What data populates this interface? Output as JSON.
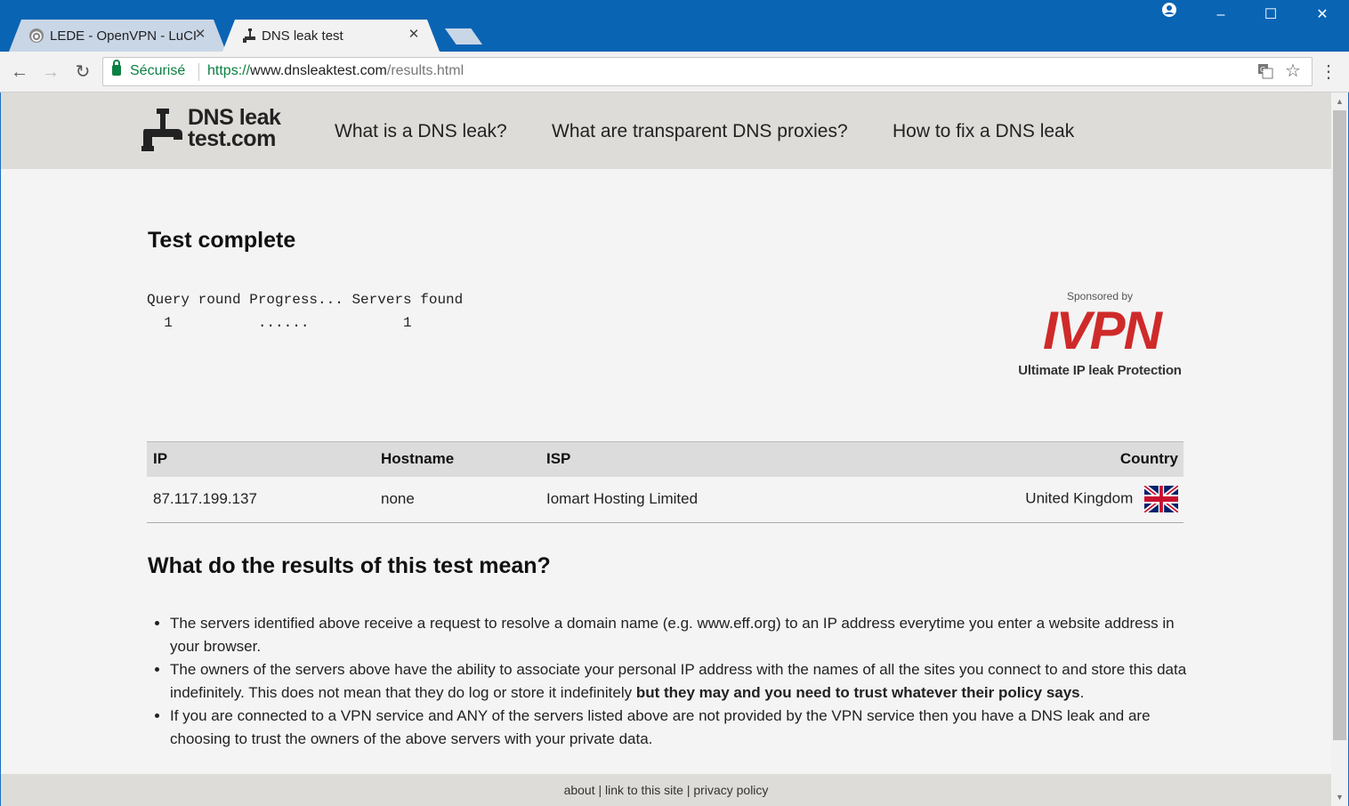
{
  "browser": {
    "tabs": [
      {
        "title": "LEDE - OpenVPN - LuCI",
        "icon": "signal-icon",
        "active": false
      },
      {
        "title": "DNS leak test",
        "icon": "faucet-icon",
        "active": true
      }
    ],
    "omnibox": {
      "secure_label": "Sécurisé",
      "url_scheme": "https://",
      "url_host": "www.dnsleaktest.com",
      "url_path": "/results.html"
    },
    "window_controls": {
      "minimize": "–",
      "maximize": "☐",
      "close": "✕"
    }
  },
  "site": {
    "logo": {
      "line1": "DNS leak",
      "line2": "test.com"
    },
    "nav": [
      "What is a DNS leak?",
      "What are transparent DNS proxies?",
      "How to fix a DNS leak"
    ]
  },
  "main": {
    "title": "Test complete",
    "progress": {
      "header": "Query round Progress... Servers found",
      "row": "  1          ......           1"
    },
    "sponsor": {
      "by": "Sponsored by",
      "brand": "IVPN",
      "tagline": "Ultimate IP leak Protection"
    },
    "table": {
      "headers": {
        "ip": "IP",
        "hostname": "Hostname",
        "isp": "ISP",
        "country": "Country"
      },
      "rows": [
        {
          "ip": "87.117.199.137",
          "hostname": "none",
          "isp": "Iomart Hosting Limited",
          "country": "United Kingdom",
          "flag_icon": "uk-flag-icon"
        }
      ]
    },
    "meaning": {
      "title": "What do the results of this test mean?",
      "items": [
        {
          "text": "The servers identified above receive a request to resolve a domain name (e.g. www.eff.org) to an IP address everytime you enter a website address in your browser."
        },
        {
          "text": "The owners of the servers above have the ability to associate your personal IP address with the names of all the sites you connect to and store this data indefinitely. This does not mean that they do log or store it indefinitely ",
          "bold": "but they may and you need to trust whatever their policy says",
          "tail": "."
        },
        {
          "text": "If you are connected to a VPN service and ANY of the servers listed above are not provided by the VPN service then you have a DNS leak and are choosing to trust the owners of the above servers with your private data."
        }
      ]
    }
  },
  "footer": {
    "about": "about",
    "sep1": " | ",
    "link": "link to this site",
    "sep2": " | ",
    "privacy": "privacy policy"
  },
  "colors": {
    "brand_red": "#cf2a2a",
    "secure_green": "#0b8043",
    "titlebar_blue": "#0a64b4"
  }
}
